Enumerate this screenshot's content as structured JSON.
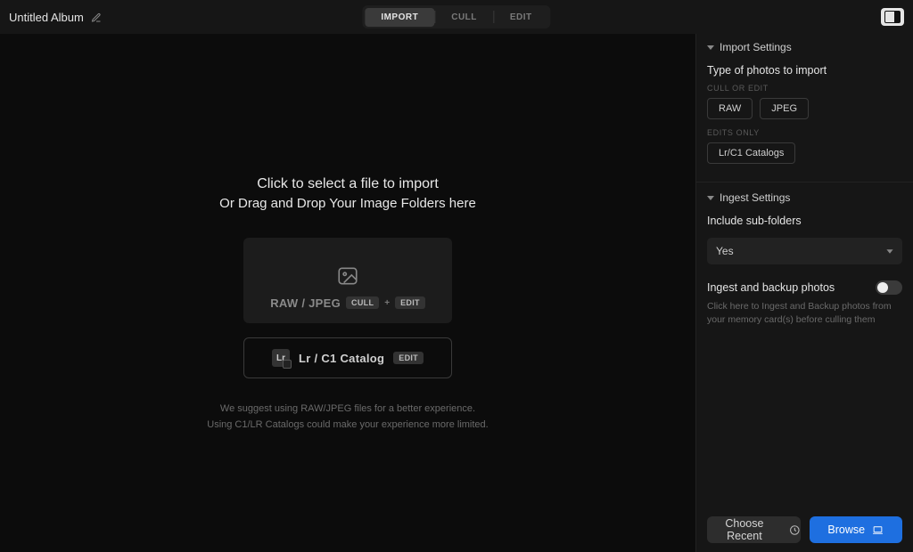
{
  "topbar": {
    "album_title": "Untitled Album",
    "tabs": {
      "import": "Import",
      "cull": "Cull",
      "edit": "Edit"
    },
    "active_tab": "import"
  },
  "center": {
    "headline": "Click to select a file to import",
    "subhead": "Or Drag and Drop Your Image Folders here",
    "tile_raw": {
      "label": "RAW / JPEG",
      "pill1": "Cull",
      "plus": "+",
      "pill2": "Edit"
    },
    "tile_catalog": {
      "label": "Lr / C1 Catalog",
      "pill": "Edit"
    },
    "hint_line1": "We suggest using RAW/JPEG files for a better experience.",
    "hint_line2": "Using C1/LR Catalogs could make your experience more limited."
  },
  "sidebar": {
    "import_settings": {
      "title": "Import Settings",
      "type_label": "Type of photos to import",
      "cull_or_edit_meta": "Cull or Edit",
      "chips": {
        "raw": "RAW",
        "jpeg": "JPEG"
      },
      "edits_only_meta": "Edits Only",
      "catalogs_chip": "Lr/C1 Catalogs"
    },
    "ingest_settings": {
      "title": "Ingest Settings",
      "subfolders_label": "Include sub-folders",
      "subfolders_value": "Yes",
      "ingest_label": "Ingest and backup photos",
      "ingest_helper": "Click here to Ingest and Backup photos from your memory card(s) before culling them"
    },
    "footer": {
      "choose_recent": "Choose Recent",
      "browse": "Browse"
    }
  }
}
